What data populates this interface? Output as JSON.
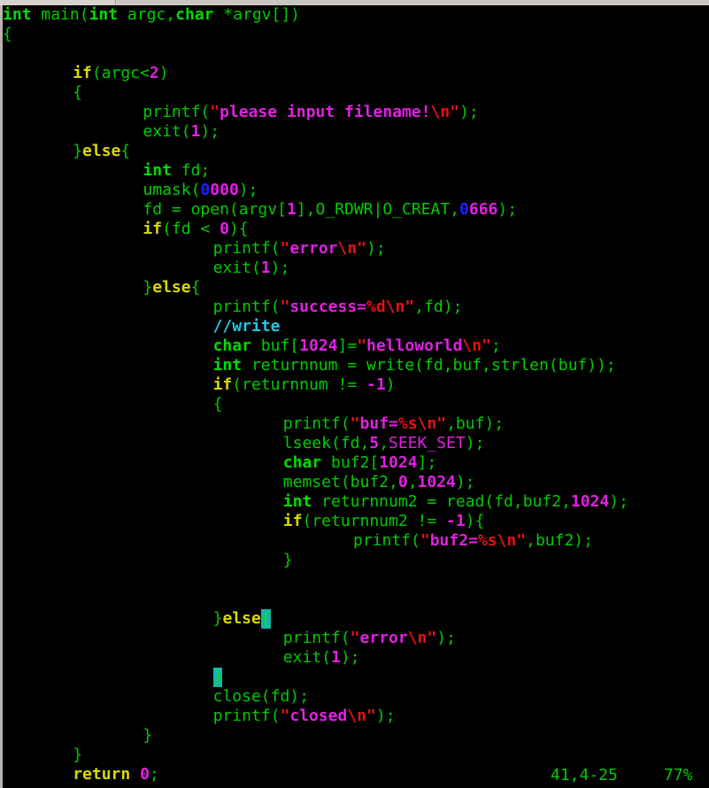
{
  "editor": {
    "name": "vim-editor",
    "background_color": "#000000",
    "font_size_px": 18,
    "line_height_px": 22
  },
  "colors": {
    "foreground": "#00cc00",
    "keyword": "#d8d800",
    "type": "#00dd00",
    "string": "#e020e0",
    "escape": "#e81010",
    "number": "#e020e0",
    "octal_prefix": "#2020ff",
    "constant": "#e020e0",
    "comment": "#20c8e0",
    "cursor_bg": "#15b2b2",
    "chrome": "#d6d3ce"
  },
  "status": {
    "position": "41,4-25",
    "percent": "77%"
  },
  "code": {
    "language": "c",
    "lines": [
      {
        "n": 1,
        "indent": 0,
        "tokens": [
          {
            "t": "int",
            "c": "type"
          },
          {
            "t": " ",
            "c": "plain"
          },
          {
            "t": "main",
            "c": "plain"
          },
          {
            "t": "(",
            "c": "plain"
          },
          {
            "t": "int",
            "c": "type"
          },
          {
            "t": " argc,",
            "c": "plain"
          },
          {
            "t": "char",
            "c": "type"
          },
          {
            "t": " *argv[])",
            "c": "plain"
          }
        ]
      },
      {
        "n": 2,
        "indent": 0,
        "tokens": [
          {
            "t": "{",
            "c": "brace"
          }
        ]
      },
      {
        "n": 3,
        "indent": 0,
        "tokens": []
      },
      {
        "n": 4,
        "indent": 8,
        "tokens": [
          {
            "t": "if",
            "c": "kw"
          },
          {
            "t": "(argc<",
            "c": "plain"
          },
          {
            "t": "2",
            "c": "num"
          },
          {
            "t": ")",
            "c": "plain"
          }
        ]
      },
      {
        "n": 5,
        "indent": 8,
        "tokens": [
          {
            "t": "{",
            "c": "brace"
          }
        ]
      },
      {
        "n": 6,
        "indent": 16,
        "tokens": [
          {
            "t": "printf",
            "c": "plain"
          },
          {
            "t": "(",
            "c": "plain"
          },
          {
            "t": "\"",
            "c": "quote"
          },
          {
            "t": "please input filename!",
            "c": "str"
          },
          {
            "t": "\\n",
            "c": "esc"
          },
          {
            "t": "\"",
            "c": "quote"
          },
          {
            "t": ")",
            "c": "plain"
          },
          {
            "t": ";",
            "c": "plain"
          }
        ]
      },
      {
        "n": 7,
        "indent": 16,
        "tokens": [
          {
            "t": "exit",
            "c": "plain"
          },
          {
            "t": "(",
            "c": "plain"
          },
          {
            "t": "1",
            "c": "num"
          },
          {
            "t": ")",
            "c": "plain"
          },
          {
            "t": ";",
            "c": "plain"
          }
        ]
      },
      {
        "n": 8,
        "indent": 8,
        "tokens": [
          {
            "t": "}",
            "c": "brace"
          },
          {
            "t": "else",
            "c": "kw"
          },
          {
            "t": "{",
            "c": "brace"
          }
        ]
      },
      {
        "n": 9,
        "indent": 16,
        "tokens": [
          {
            "t": "int",
            "c": "type"
          },
          {
            "t": " fd",
            "c": "plain"
          },
          {
            "t": ";",
            "c": "plain"
          }
        ]
      },
      {
        "n": 10,
        "indent": 16,
        "tokens": [
          {
            "t": "umask",
            "c": "plain"
          },
          {
            "t": "(",
            "c": "plain"
          },
          {
            "t": "0",
            "c": "octpfx"
          },
          {
            "t": "000",
            "c": "num"
          },
          {
            "t": ")",
            "c": "plain"
          },
          {
            "t": ";",
            "c": "plain"
          }
        ]
      },
      {
        "n": 11,
        "indent": 16,
        "tokens": [
          {
            "t": "fd = open(argv[",
            "c": "plain"
          },
          {
            "t": "1",
            "c": "num"
          },
          {
            "t": "],O_RDWR|O_CREAT,",
            "c": "plain"
          },
          {
            "t": "0",
            "c": "octpfx"
          },
          {
            "t": "666",
            "c": "num"
          },
          {
            "t": ")",
            "c": "plain"
          },
          {
            "t": ";",
            "c": "plain"
          }
        ]
      },
      {
        "n": 12,
        "indent": 16,
        "tokens": [
          {
            "t": "if",
            "c": "kw"
          },
          {
            "t": "(fd < ",
            "c": "plain"
          },
          {
            "t": "0",
            "c": "num"
          },
          {
            "t": ")",
            "c": "plain"
          },
          {
            "t": "{",
            "c": "brace"
          }
        ]
      },
      {
        "n": 13,
        "indent": 24,
        "tokens": [
          {
            "t": "printf",
            "c": "plain"
          },
          {
            "t": "(",
            "c": "plain"
          },
          {
            "t": "\"",
            "c": "quote"
          },
          {
            "t": "error",
            "c": "str"
          },
          {
            "t": "\\n",
            "c": "esc"
          },
          {
            "t": "\"",
            "c": "quote"
          },
          {
            "t": ")",
            "c": "plain"
          },
          {
            "t": ";",
            "c": "plain"
          }
        ]
      },
      {
        "n": 14,
        "indent": 24,
        "tokens": [
          {
            "t": "exit",
            "c": "plain"
          },
          {
            "t": "(",
            "c": "plain"
          },
          {
            "t": "1",
            "c": "num"
          },
          {
            "t": ")",
            "c": "plain"
          },
          {
            "t": ";",
            "c": "plain"
          }
        ]
      },
      {
        "n": 15,
        "indent": 16,
        "tokens": [
          {
            "t": "}",
            "c": "brace"
          },
          {
            "t": "else",
            "c": "kw"
          },
          {
            "t": "{",
            "c": "brace"
          }
        ]
      },
      {
        "n": 16,
        "indent": 24,
        "tokens": [
          {
            "t": "printf",
            "c": "plain"
          },
          {
            "t": "(",
            "c": "plain"
          },
          {
            "t": "\"",
            "c": "quote"
          },
          {
            "t": "success=",
            "c": "str"
          },
          {
            "t": "%d",
            "c": "esc"
          },
          {
            "t": "\\n",
            "c": "esc"
          },
          {
            "t": "\"",
            "c": "quote"
          },
          {
            "t": ",fd)",
            "c": "plain"
          },
          {
            "t": ";",
            "c": "plain"
          }
        ]
      },
      {
        "n": 17,
        "indent": 24,
        "tokens": [
          {
            "t": "//write",
            "c": "comment"
          }
        ]
      },
      {
        "n": 18,
        "indent": 24,
        "tokens": [
          {
            "t": "char",
            "c": "type"
          },
          {
            "t": " buf[",
            "c": "plain"
          },
          {
            "t": "1024",
            "c": "num"
          },
          {
            "t": "]=",
            "c": "plain"
          },
          {
            "t": "\"",
            "c": "quote"
          },
          {
            "t": "helloworld",
            "c": "str"
          },
          {
            "t": "\\n",
            "c": "esc"
          },
          {
            "t": "\"",
            "c": "quote"
          },
          {
            "t": ";",
            "c": "plain"
          }
        ]
      },
      {
        "n": 19,
        "indent": 24,
        "tokens": [
          {
            "t": "int",
            "c": "type"
          },
          {
            "t": " returnnum = write(fd,buf,strlen(buf))",
            "c": "plain"
          },
          {
            "t": ";",
            "c": "plain"
          }
        ]
      },
      {
        "n": 20,
        "indent": 24,
        "tokens": [
          {
            "t": "if",
            "c": "kw"
          },
          {
            "t": "(returnnum != ",
            "c": "plain"
          },
          {
            "t": "-",
            "c": "num"
          },
          {
            "t": "1",
            "c": "num"
          },
          {
            "t": ")",
            "c": "plain"
          }
        ]
      },
      {
        "n": 21,
        "indent": 24,
        "tokens": [
          {
            "t": "{",
            "c": "brace"
          }
        ]
      },
      {
        "n": 22,
        "indent": 32,
        "tokens": [
          {
            "t": "printf",
            "c": "plain"
          },
          {
            "t": "(",
            "c": "plain"
          },
          {
            "t": "\"",
            "c": "quote"
          },
          {
            "t": "buf=",
            "c": "str"
          },
          {
            "t": "%s",
            "c": "esc"
          },
          {
            "t": "\\n",
            "c": "esc"
          },
          {
            "t": "\"",
            "c": "quote"
          },
          {
            "t": ",buf)",
            "c": "plain"
          },
          {
            "t": ";",
            "c": "plain"
          }
        ]
      },
      {
        "n": 23,
        "indent": 32,
        "tokens": [
          {
            "t": "lseek(fd,",
            "c": "plain"
          },
          {
            "t": "5",
            "c": "num"
          },
          {
            "t": ",",
            "c": "plain"
          },
          {
            "t": "SEEK_SET",
            "c": "const"
          },
          {
            "t": ")",
            "c": "plain"
          },
          {
            "t": ";",
            "c": "plain"
          }
        ]
      },
      {
        "n": 24,
        "indent": 32,
        "tokens": [
          {
            "t": "char",
            "c": "type"
          },
          {
            "t": " buf2[",
            "c": "plain"
          },
          {
            "t": "1024",
            "c": "num"
          },
          {
            "t": "]",
            "c": "plain"
          },
          {
            "t": ";",
            "c": "plain"
          }
        ]
      },
      {
        "n": 25,
        "indent": 32,
        "tokens": [
          {
            "t": "memset(buf2,",
            "c": "plain"
          },
          {
            "t": "0",
            "c": "num"
          },
          {
            "t": ",",
            "c": "plain"
          },
          {
            "t": "1024",
            "c": "num"
          },
          {
            "t": ")",
            "c": "plain"
          },
          {
            "t": ";",
            "c": "plain"
          }
        ]
      },
      {
        "n": 26,
        "indent": 32,
        "tokens": [
          {
            "t": "int",
            "c": "type"
          },
          {
            "t": " returnnum2 = read(fd,buf2,",
            "c": "plain"
          },
          {
            "t": "1024",
            "c": "num"
          },
          {
            "t": ")",
            "c": "plain"
          },
          {
            "t": ";",
            "c": "plain"
          }
        ]
      },
      {
        "n": 27,
        "indent": 32,
        "tokens": [
          {
            "t": "if",
            "c": "kw"
          },
          {
            "t": "(returnnum2 != ",
            "c": "plain"
          },
          {
            "t": "-",
            "c": "num"
          },
          {
            "t": "1",
            "c": "num"
          },
          {
            "t": ")",
            "c": "plain"
          },
          {
            "t": "{",
            "c": "brace"
          }
        ]
      },
      {
        "n": 28,
        "indent": 40,
        "tokens": [
          {
            "t": "printf",
            "c": "plain"
          },
          {
            "t": "(",
            "c": "plain"
          },
          {
            "t": "\"",
            "c": "quote"
          },
          {
            "t": "buf2=",
            "c": "str"
          },
          {
            "t": "%s",
            "c": "esc"
          },
          {
            "t": "\\n",
            "c": "esc"
          },
          {
            "t": "\"",
            "c": "quote"
          },
          {
            "t": ",buf2)",
            "c": "plain"
          },
          {
            "t": ";",
            "c": "plain"
          }
        ]
      },
      {
        "n": 29,
        "indent": 32,
        "tokens": [
          {
            "t": "}",
            "c": "brace"
          }
        ]
      },
      {
        "n": 30,
        "indent": 0,
        "tokens": []
      },
      {
        "n": 31,
        "indent": 0,
        "tokens": []
      },
      {
        "n": 32,
        "indent": 24,
        "tokens": [
          {
            "t": "}",
            "c": "brace"
          },
          {
            "t": "else",
            "c": "kw"
          },
          {
            "t": "{",
            "c": "cursor"
          }
        ]
      },
      {
        "n": 33,
        "indent": 32,
        "tokens": [
          {
            "t": "printf",
            "c": "plain"
          },
          {
            "t": "(",
            "c": "plain"
          },
          {
            "t": "\"",
            "c": "quote"
          },
          {
            "t": "error",
            "c": "str"
          },
          {
            "t": "\\n",
            "c": "esc"
          },
          {
            "t": "\"",
            "c": "quote"
          },
          {
            "t": ")",
            "c": "plain"
          },
          {
            "t": ";",
            "c": "plain"
          }
        ]
      },
      {
        "n": 34,
        "indent": 32,
        "tokens": [
          {
            "t": "exit",
            "c": "plain"
          },
          {
            "t": "(",
            "c": "plain"
          },
          {
            "t": "1",
            "c": "num"
          },
          {
            "t": ")",
            "c": "plain"
          },
          {
            "t": ";",
            "c": "plain"
          }
        ]
      },
      {
        "n": 35,
        "indent": 24,
        "tokens": [
          {
            "t": "}",
            "c": "cursor"
          }
        ]
      },
      {
        "n": 36,
        "indent": 24,
        "tokens": [
          {
            "t": "close(fd)",
            "c": "plain"
          },
          {
            "t": ";",
            "c": "plain"
          }
        ]
      },
      {
        "n": 37,
        "indent": 24,
        "tokens": [
          {
            "t": "printf",
            "c": "plain"
          },
          {
            "t": "(",
            "c": "plain"
          },
          {
            "t": "\"",
            "c": "quote"
          },
          {
            "t": "closed",
            "c": "str"
          },
          {
            "t": "\\n",
            "c": "esc"
          },
          {
            "t": "\"",
            "c": "quote"
          },
          {
            "t": ")",
            "c": "plain"
          },
          {
            "t": ";",
            "c": "plain"
          }
        ]
      },
      {
        "n": 38,
        "indent": 16,
        "tokens": [
          {
            "t": "}",
            "c": "brace"
          }
        ]
      },
      {
        "n": 39,
        "indent": 8,
        "tokens": [
          {
            "t": "}",
            "c": "brace"
          }
        ]
      },
      {
        "n": 40,
        "indent": 8,
        "tokens": [
          {
            "t": "return",
            "c": "kw"
          },
          {
            "t": " ",
            "c": "plain"
          },
          {
            "t": "0",
            "c": "num"
          },
          {
            "t": ";",
            "c": "plain"
          }
        ]
      }
    ]
  }
}
